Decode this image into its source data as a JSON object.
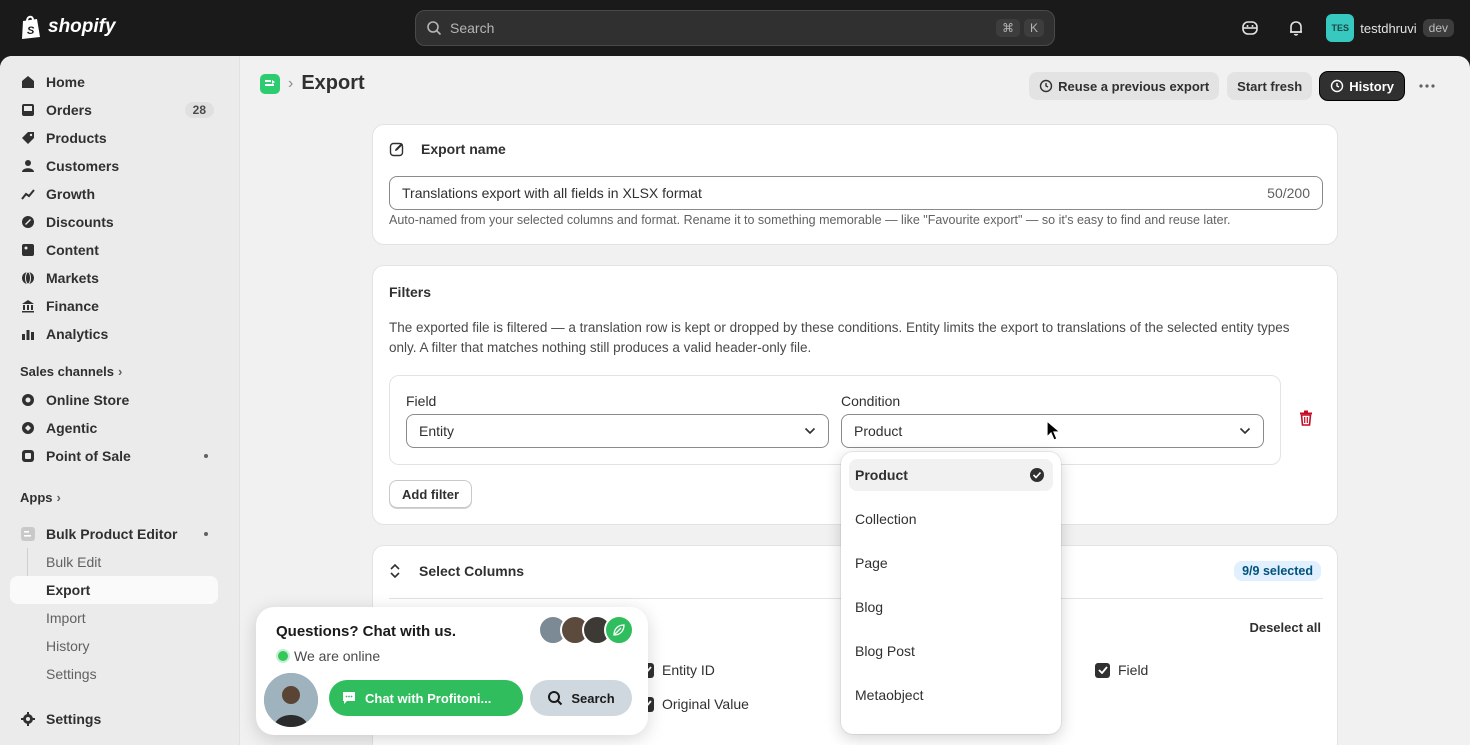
{
  "topbar": {
    "brand": "shopify",
    "search_placeholder": "Search",
    "shortcut_keys": [
      "⌘",
      "K"
    ],
    "user_initials": "TES",
    "user_name": "testdhruvi",
    "user_badge": "dev"
  },
  "sidebar": {
    "items": [
      {
        "label": "Home",
        "icon": "home-icon"
      },
      {
        "label": "Orders",
        "icon": "inbox-icon",
        "badge": "28"
      },
      {
        "label": "Products",
        "icon": "tag-icon"
      },
      {
        "label": "Customers",
        "icon": "person-icon"
      },
      {
        "label": "Growth",
        "icon": "growth-icon"
      },
      {
        "label": "Discounts",
        "icon": "discount-icon"
      },
      {
        "label": "Content",
        "icon": "content-icon"
      },
      {
        "label": "Markets",
        "icon": "globe-icon"
      },
      {
        "label": "Finance",
        "icon": "bank-icon"
      },
      {
        "label": "Analytics",
        "icon": "chart-icon"
      }
    ],
    "sales_channels_label": "Sales channels",
    "channels": [
      {
        "label": "Online Store"
      },
      {
        "label": "Agentic"
      },
      {
        "label": "Point of Sale"
      }
    ],
    "apps_label": "Apps",
    "app_name": "Bulk Product Editor",
    "app_subitems": [
      "Bulk Edit",
      "Export",
      "Import",
      "History",
      "Settings"
    ],
    "settings_label": "Settings"
  },
  "page": {
    "title": "Export",
    "actions": {
      "reuse": "Reuse a previous export",
      "start_fresh": "Start fresh",
      "history": "History"
    }
  },
  "export_name": {
    "title": "Export name",
    "value": "Translations export with all fields in XLSX format",
    "counter": "50/200",
    "help": "Auto-named from your selected columns and format. Rename it to something memorable — like \"Favourite export\" — so it's easy to find and reuse later."
  },
  "filters": {
    "title": "Filters",
    "description": "The exported file is filtered — a translation row is kept or dropped by these conditions. Entity limits the export to translations of the selected entity types only. A filter that matches nothing still produces a valid header-only file.",
    "field_label": "Field",
    "field_value": "Entity",
    "condition_label": "Condition",
    "condition_value": "Product",
    "add_filter": "Add filter"
  },
  "dropdown": {
    "options": [
      "Product",
      "Collection",
      "Page",
      "Blog",
      "Blog Post",
      "Metaobject"
    ],
    "selected": "Product"
  },
  "columns": {
    "title": "Select Columns",
    "selected_badge": "9/9 selected",
    "deselect_all": "Deselect all",
    "items": [
      "Entity ID",
      "Original Value",
      "Field"
    ]
  },
  "chat": {
    "title": "Questions? Chat with us.",
    "status": "We are online",
    "chat_button": "Chat with Profitoni...",
    "search_button": "Search"
  },
  "colors": {
    "accent_green": "#2fbd5d",
    "delete_red": "#c70a24",
    "badge_blue": "#e0f0ff"
  }
}
